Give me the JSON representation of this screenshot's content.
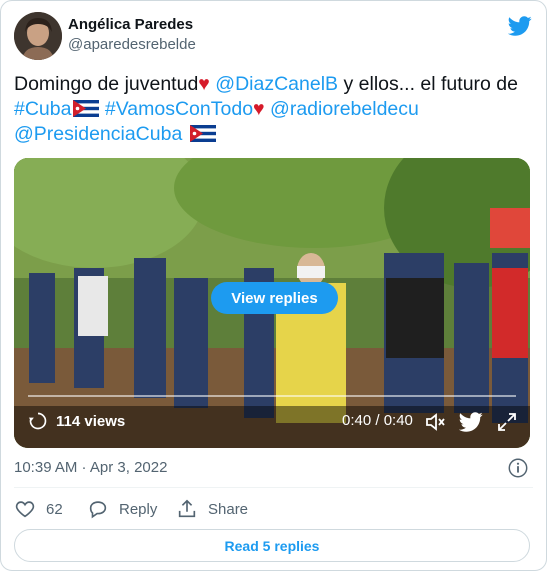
{
  "author": {
    "name": "Angélica Paredes",
    "handle": "@aparedesrebelde"
  },
  "tweet": {
    "text_1": "Domingo de juventud",
    "mention_1": "@DiazCanelB",
    "text_2": " y ellos... el futuro de ",
    "hashtag_1": "#Cuba",
    "hashtag_2": "#VamosConTodo",
    "mention_2": "@radiorebeldecu",
    "mention_3": "@PresidenciaCuba"
  },
  "media": {
    "view_replies_label": "View replies",
    "views_label": "114 views",
    "time_label": "0:40 / 0:40"
  },
  "meta": {
    "timestamp": "10:39 AM · Apr 3, 2022"
  },
  "actions": {
    "like_count": "62",
    "reply_label": "Reply",
    "share_label": "Share"
  },
  "read_replies_label": "Read 5 replies",
  "colors": {
    "accent": "#1d9bf0",
    "heart": "#d61a2a",
    "text_secondary": "#536471"
  },
  "icons": [
    "twitter-bird-icon",
    "heart-icon",
    "cuba-flag-icon",
    "views-icon",
    "volume-icon",
    "twitter-logo-icon",
    "expand-icon",
    "info-icon",
    "reply-icon",
    "share-icon"
  ]
}
